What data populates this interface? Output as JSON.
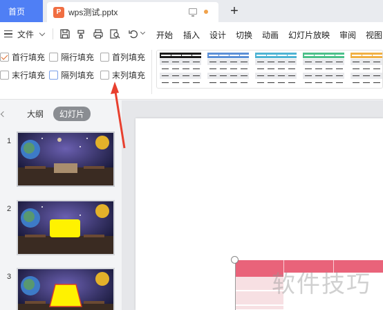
{
  "tabbar": {
    "home_label": "首页",
    "doc_icon_letter": "P",
    "doc_name": "wps测试.pptx",
    "new_tab_label": "+"
  },
  "menubar": {
    "file_label": "文件",
    "items": [
      "开始",
      "插入",
      "设计",
      "切换",
      "动画",
      "幻灯片放映",
      "审阅",
      "视图"
    ]
  },
  "ribbon": {
    "options": [
      {
        "label": "首行填充",
        "checked": true
      },
      {
        "label": "隔行填充",
        "checked": false
      },
      {
        "label": "首列填充",
        "checked": false
      },
      {
        "label": "末行填充",
        "checked": false
      },
      {
        "label": "隔列填充",
        "checked": false
      },
      {
        "label": "末列填充",
        "checked": false
      }
    ],
    "style_colors": [
      "#1a1a1a",
      "#5b8fd6",
      "#4eb3d3",
      "#4cc08a",
      "#f0b044"
    ]
  },
  "leftpanel": {
    "outline_tab": "大纲",
    "slides_tab": "幻灯片",
    "slide_numbers": [
      "1",
      "2",
      "3"
    ]
  },
  "canvas": {
    "table_header_color": "#e9637a",
    "watermark": "软件技巧"
  },
  "colors": {
    "accent_blue": "#4f7ff5",
    "annotation_red": "#e8402f"
  }
}
